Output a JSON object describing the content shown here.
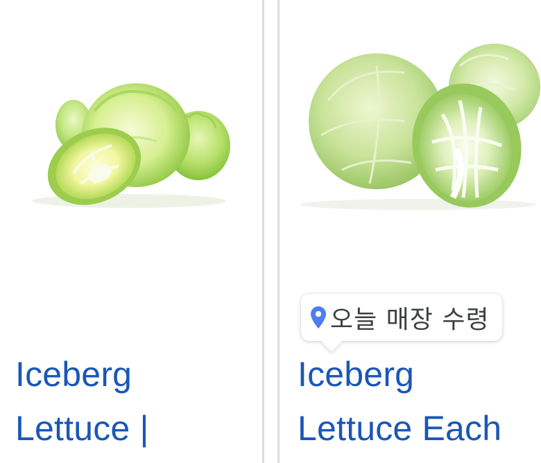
{
  "products": [
    {
      "image_alt": "iceberg lettuce",
      "title_line1": "Iceberg",
      "title_line2": "Lettuce |"
    },
    {
      "image_alt": "iceberg lettuce",
      "title_line1": "Iceberg",
      "title_line2": "Lettuce Each",
      "badge": {
        "icon": "location-pin-icon",
        "text": "오늘 매장 수령"
      }
    }
  ],
  "colors": {
    "title": "#1a56b8",
    "pin": "#4a7ff0",
    "divider": "#dadce0"
  }
}
